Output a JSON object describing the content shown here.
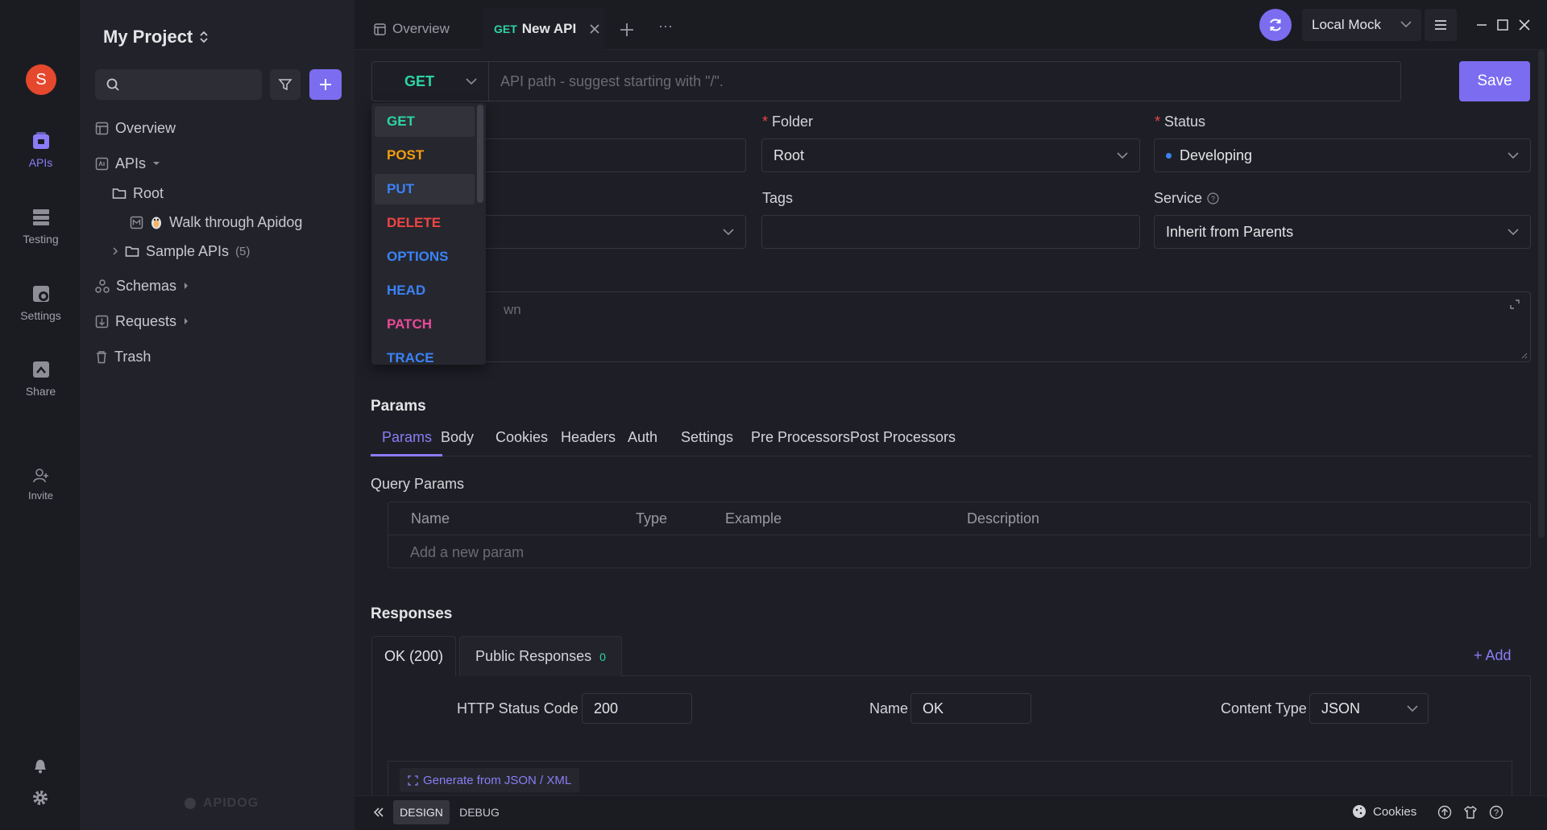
{
  "rail": {
    "avatar_letter": "S",
    "items": [
      {
        "label": "APIs",
        "icon": "api-icon"
      },
      {
        "label": "Testing",
        "icon": "testing-icon"
      },
      {
        "label": "Settings",
        "icon": "settings-icon"
      },
      {
        "label": "Share",
        "icon": "share-icon"
      },
      {
        "label": "Invite",
        "icon": "invite-icon"
      }
    ]
  },
  "sidebar": {
    "project_name": "My Project",
    "tree": {
      "overview": "Overview",
      "apis": "APIs",
      "root": "Root",
      "walk_through": "Walk through Apidog",
      "sample_apis": "Sample APIs",
      "sample_count": "(5)",
      "schemas": "Schemas",
      "requests": "Requests",
      "trash": "Trash"
    },
    "watermark": "APIDOG"
  },
  "tabs": {
    "overview": "Overview",
    "active_method": "GET",
    "active_title": "New API",
    "more": "···"
  },
  "header": {
    "env": "Local Mock"
  },
  "request": {
    "method": "GET",
    "path_placeholder": "API path - suggest starting with \"/\".",
    "save": "Save"
  },
  "methods": [
    {
      "label": "GET",
      "color": "#2dd4a7"
    },
    {
      "label": "POST",
      "color": "#f59e0b"
    },
    {
      "label": "PUT",
      "color": "#3b82f6"
    },
    {
      "label": "DELETE",
      "color": "#ef4444"
    },
    {
      "label": "OPTIONS",
      "color": "#3b82f6"
    },
    {
      "label": "HEAD",
      "color": "#3b82f6"
    },
    {
      "label": "PATCH",
      "color": "#ec4899"
    },
    {
      "label": "TRACE",
      "color": "#3b82f6"
    }
  ],
  "form": {
    "folder_label": "Folder",
    "folder_value": "Root",
    "status_label": "Status",
    "status_value": "Developing",
    "tags_label": "Tags",
    "service_label": "Service",
    "service_value": "Inherit from Parents",
    "desc_fragment": "wn"
  },
  "params": {
    "title": "Params",
    "tabs": [
      "Params",
      "Body",
      "Cookies",
      "Headers",
      "Auth",
      "Settings",
      "Pre Processors",
      "Post Processors"
    ],
    "query_title": "Query Params",
    "columns": [
      "Name",
      "Type",
      "Example",
      "Description"
    ],
    "add_placeholder": "Add a new param"
  },
  "responses": {
    "title": "Responses",
    "tab_ok": "OK (200)",
    "tab_public": "Public Responses",
    "public_count": "0",
    "add": "+ Add",
    "status_code_label": "HTTP Status Code",
    "status_code": "200",
    "name_label": "Name",
    "name_value": "OK",
    "content_type_label": "Content Type",
    "content_type": "JSON",
    "generate": "Generate from JSON / XML"
  },
  "footer": {
    "design": "DESIGN",
    "debug": "DEBUG",
    "cookies": "Cookies"
  },
  "colors": {
    "accent": "#7c6cf0",
    "get": "#2dd4a7",
    "status_dot": "#3b82f6",
    "avatar": "#e5482d"
  }
}
